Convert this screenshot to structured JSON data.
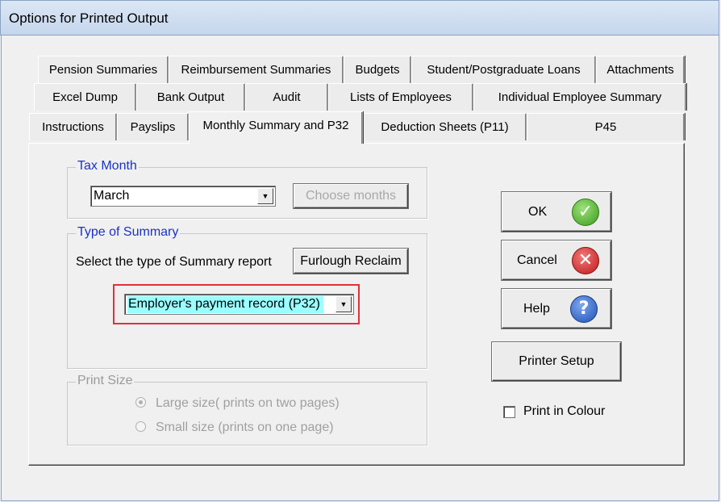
{
  "window": {
    "title": "Options for Printed Output"
  },
  "tabs": {
    "row1": [
      "Pension Summaries",
      "Reimbursement Summaries",
      "Budgets",
      "Student/Postgraduate Loans",
      "Attachments"
    ],
    "row2": [
      "Excel Dump",
      "Bank Output",
      "Audit",
      "Lists of Employees",
      "Individual Employee Summary"
    ],
    "row3": [
      "Instructions",
      "Payslips",
      "Monthly Summary and P32",
      "Deduction Sheets (P11)",
      "P45"
    ],
    "active": "Monthly Summary and P32"
  },
  "tax_month": {
    "legend": "Tax Month",
    "selected": "March",
    "choose_months_label": "Choose months"
  },
  "summary": {
    "legend": "Type of Summary",
    "prompt": "Select the type of Summary report",
    "furlough_label": "Furlough Reclaim",
    "selected": "Employer's payment record (P32)",
    "highlight_color": "#e0303a",
    "selected_bg": "#99ffff"
  },
  "print_size": {
    "legend": "Print Size",
    "large_label": "Large size( prints on two pages)",
    "small_label": "Small size (prints on one page)",
    "selected": "large"
  },
  "buttons": {
    "ok_label": "OK",
    "cancel_label": "Cancel",
    "help_label": "Help",
    "printer_setup_label": "Printer Setup",
    "ok_icon": "checkmark-icon",
    "cancel_icon": "x-icon",
    "help_icon": "question-icon"
  },
  "colour": {
    "label": "Print in Colour",
    "checked": false
  }
}
